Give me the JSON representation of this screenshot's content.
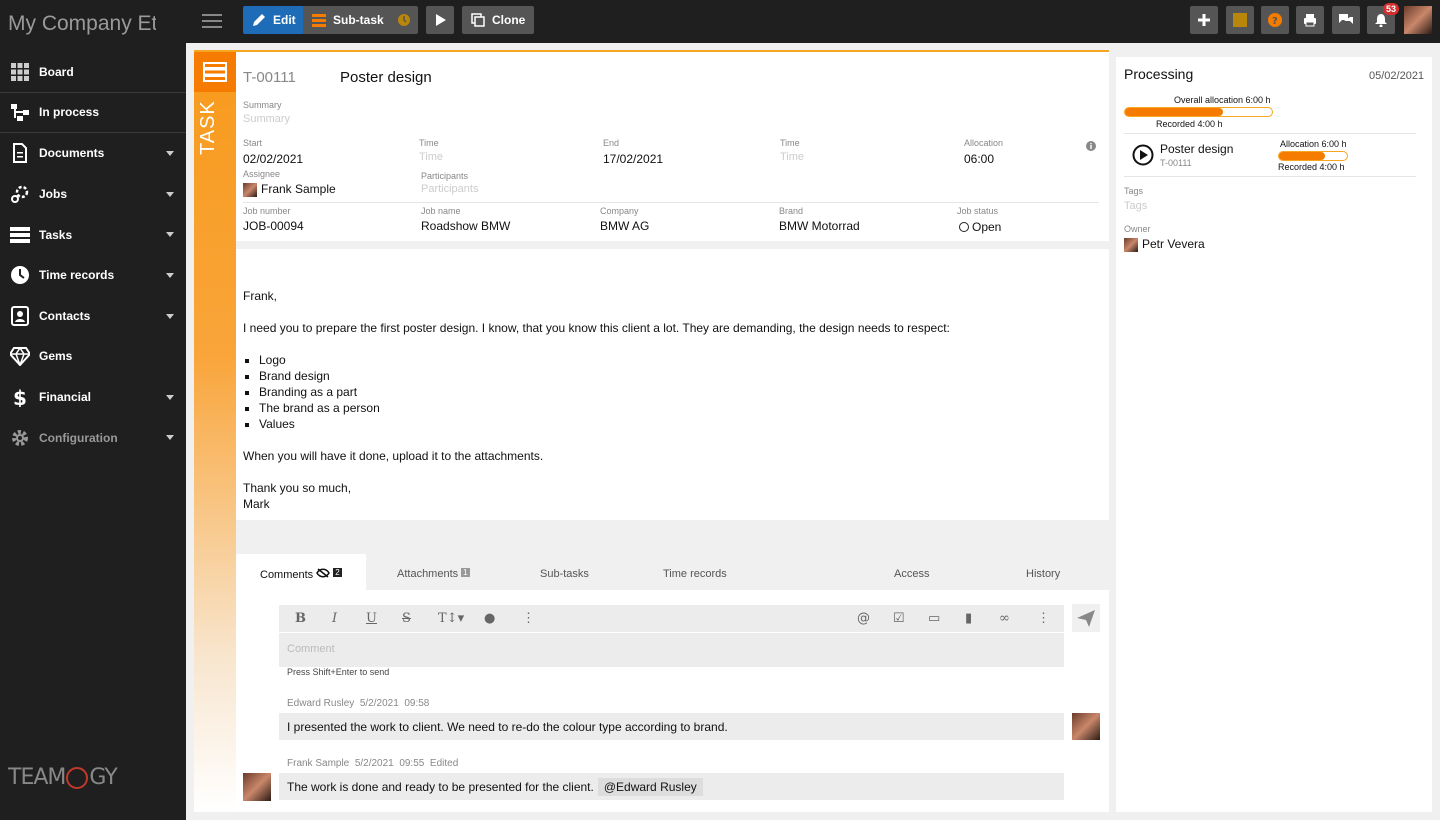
{
  "app": {
    "title": "My Company Et"
  },
  "sidebar": {
    "items": [
      {
        "label": "Board",
        "icon": "grid-icon"
      },
      {
        "label": "In process",
        "icon": "flow-icon"
      },
      {
        "label": "Documents",
        "icon": "document-icon"
      },
      {
        "label": "Jobs",
        "icon": "jobs-icon"
      },
      {
        "label": "Tasks",
        "icon": "tasks-icon"
      },
      {
        "label": "Time records",
        "icon": "clock-icon"
      },
      {
        "label": "Contacts",
        "icon": "contacts-icon"
      },
      {
        "label": "Gems",
        "icon": "gem-icon"
      },
      {
        "label": "Financial",
        "icon": "dollar-icon"
      },
      {
        "label": "Configuration",
        "icon": "gear-icon"
      }
    ],
    "logo": "TEAMOGY"
  },
  "toolbar": {
    "edit": "Edit",
    "subtask": "Sub-task",
    "clone": "Clone",
    "notifications": "53"
  },
  "task": {
    "label": "TASK",
    "id": "T-00111",
    "title": "Poster design",
    "summary_label": "Summary",
    "summary_ph": "Summary",
    "start_label": "Start",
    "start": "02/02/2021",
    "time_label": "Time",
    "time_ph": "Time",
    "end_label": "End",
    "end": "17/02/2021",
    "time2_label": "Time",
    "time2_ph": "Time",
    "alloc_label": "Allocation",
    "alloc": "06:00",
    "assignee_label": "Assignee",
    "assignee": "Frank Sample",
    "participants_label": "Participants",
    "participants_ph": "Participants",
    "jobnum_label": "Job number",
    "jobnum": "JOB-00094",
    "jobname_label": "Job name",
    "jobname": "Roadshow BMW",
    "company_label": "Company",
    "company": "BMW AG",
    "brand_label": "Brand",
    "brand": "BMW Motorrad",
    "status_label": "Job status",
    "status": "Open"
  },
  "description": {
    "greeting": "Frank,",
    "para1": "I need you to prepare the first poster design. I know, that you know this client a lot. They are demanding, the design needs to respect:",
    "list": [
      "Logo",
      "Brand design",
      "Branding as a part",
      "The brand as a person",
      "Values"
    ],
    "para2": "When you will have it done, upload it to the attachments.",
    "thanks": "Thank you so much,",
    "sign": "Mark"
  },
  "tabs": {
    "comments": "Comments",
    "comments_count": "2",
    "attachments": "Attachments",
    "attachments_count": "1",
    "subtasks": "Sub-tasks",
    "timerecords": "Time records",
    "access": "Access",
    "history": "History"
  },
  "editor": {
    "placeholder": "Comment",
    "hint": "Press Shift+Enter to send"
  },
  "comments": [
    {
      "author": "Edward Rusley",
      "date": "5/2/2021",
      "time": "09:58",
      "edited": "",
      "text": "I presented the work to client. We need to re-do the colour type according to brand.",
      "mention": ""
    },
    {
      "author": "Frank Sample",
      "date": "5/2/2021",
      "time": "09:55",
      "edited": "Edited",
      "text": "The work is done and ready to be presented for the client.",
      "mention": "@Edward Rusley"
    }
  ],
  "panel": {
    "title": "Processing",
    "date": "05/02/2021",
    "overall_label": "Overall allocation 6:00 h",
    "overall_recorded": "Recorded 4:00 h",
    "overall_fraction": 0.67,
    "item_title": "Poster design",
    "item_id": "T-00111",
    "item_alloc": "Allocation 6:00 h",
    "item_recorded": "Recorded 4:00 h",
    "item_fraction": 0.67,
    "tags_label": "Tags",
    "tags_ph": "Tags",
    "owner_label": "Owner",
    "owner": "Petr Vevera"
  },
  "colors": {
    "accent": "#f57c00",
    "edit_btn": "#1e6bb8"
  }
}
